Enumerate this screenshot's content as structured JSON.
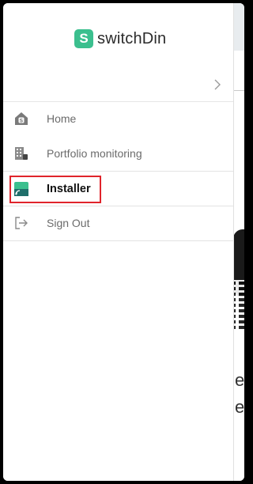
{
  "brand": {
    "logo_letter": "S",
    "name": "switchDin",
    "accent": "#3bbf8e"
  },
  "drawer": {
    "collapse_icon": "chevron-right-icon",
    "items": [
      {
        "label": "Home",
        "icon": "home-icon"
      },
      {
        "label": "Portfolio monitoring",
        "icon": "building-icon"
      },
      {
        "label": "Installer",
        "icon": "installer-device-icon",
        "active": true
      },
      {
        "label": "Sign Out",
        "icon": "sign-out-icon"
      }
    ]
  },
  "background": {
    "fragments": [
      "e",
      "eg"
    ]
  },
  "highlight_color": "#e0242b"
}
